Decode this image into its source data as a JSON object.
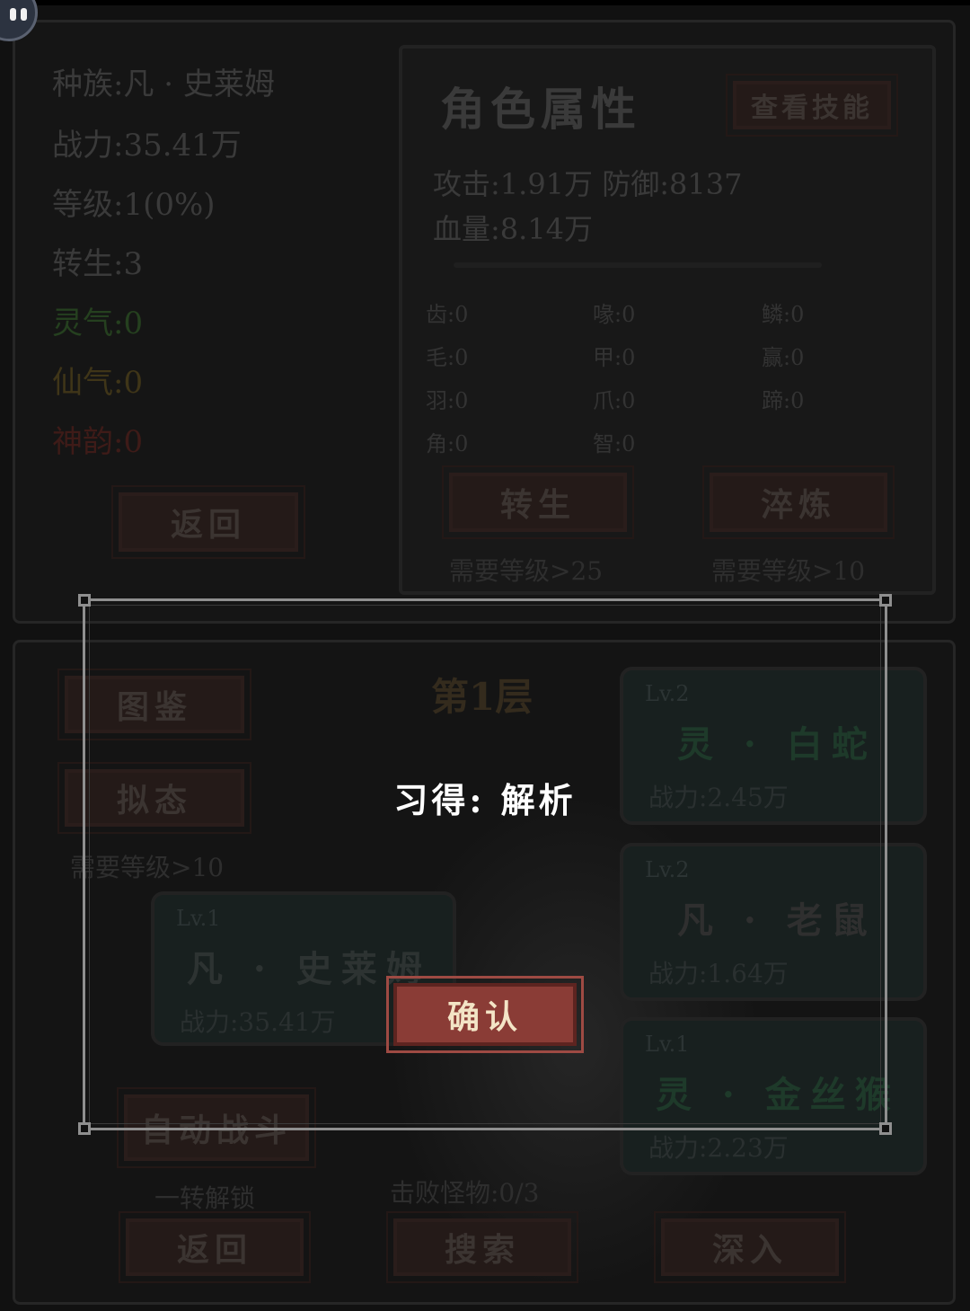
{
  "status": {
    "race": "种族:凡 · 史莱姆",
    "power": "战力:35.41万",
    "level": "等级:1(0%)",
    "rebirth": "转生:3",
    "lingqi": "灵气:0",
    "xianqi": "仙气:0",
    "shenyun": "神韵:0",
    "back_label": "返回"
  },
  "attributes": {
    "title": "角色属性",
    "view_skills_label": "查看技能",
    "attack_defense": "攻击:1.91万 防御:8137",
    "hp": "血量:8.14万",
    "traits": [
      [
        "齿:0",
        "喙:0",
        "鳞:0"
      ],
      [
        "毛:0",
        "甲:0",
        "赢:0"
      ],
      [
        "羽:0",
        "爪:0",
        "蹄:0"
      ],
      [
        "角:0",
        "智:0",
        ""
      ]
    ],
    "rebirth_label": "转生",
    "refine_label": "淬炼",
    "rebirth_req": "需要等级>25",
    "refine_req": "需要等级>10"
  },
  "dungeon": {
    "floor": "第1层",
    "codex_label": "图鉴",
    "mimic_label": "拟态",
    "mimic_req": "需要等级>10",
    "player": {
      "lv": "Lv.1",
      "name": "凡 · 史莱姆",
      "power": "战力:35.41万"
    },
    "enemies": [
      {
        "lv": "Lv.2",
        "name": "灵 · 白蛇",
        "power": "战力:2.45万",
        "color": "#1e3a2a"
      },
      {
        "lv": "Lv.2",
        "name": "凡 · 老鼠",
        "power": "战力:1.64万",
        "color": "#2f2f2f"
      },
      {
        "lv": "Lv.1",
        "name": "灵 · 金丝猴",
        "power": "战力:2.23万",
        "color": "#1e3a2a"
      }
    ],
    "auto_battle_label": "自动战斗",
    "auto_battle_hint": "一转解锁",
    "defeated": "击败怪物:0/3",
    "back_label": "返回",
    "search_label": "搜索",
    "deeper_label": "深入"
  },
  "dialog": {
    "message": "习得: 解析",
    "confirm_label": "确认"
  }
}
